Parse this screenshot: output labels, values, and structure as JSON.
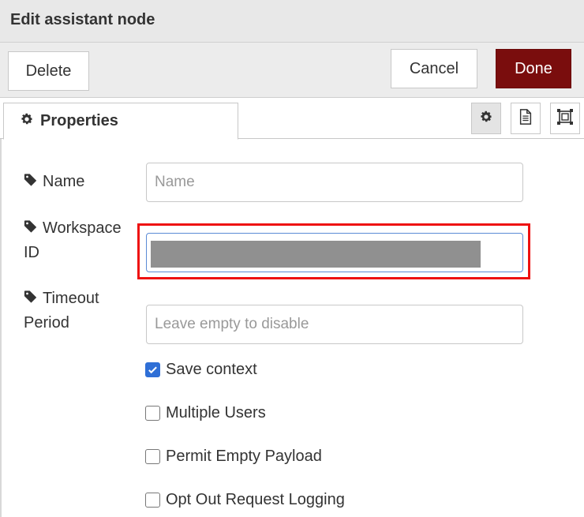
{
  "window": {
    "title": "Edit assistant node"
  },
  "toolbar": {
    "delete_label": "Delete",
    "cancel_label": "Cancel",
    "done_label": "Done",
    "done_color": "#7a0d0d"
  },
  "tabs": {
    "properties_label": "Properties",
    "icons": [
      "gear-icon",
      "document-icon",
      "frame-icon"
    ]
  },
  "form": {
    "name": {
      "label": "Name",
      "value": "",
      "placeholder": "Name"
    },
    "workspace_id": {
      "label_line1": "Workspace",
      "label_line2": "ID",
      "value": ""
    },
    "timeout": {
      "label_line1": "Timeout",
      "label_line2": "Period",
      "value": "",
      "placeholder": "Leave empty to disable"
    },
    "checkboxes": [
      {
        "label": "Save context",
        "checked": true
      },
      {
        "label": "Multiple Users",
        "checked": false
      },
      {
        "label": "Permit Empty Payload",
        "checked": false
      },
      {
        "label": "Opt Out Request Logging",
        "checked": false
      }
    ]
  },
  "highlight_color": "#e11111",
  "accent_color": "#2f6fd6"
}
